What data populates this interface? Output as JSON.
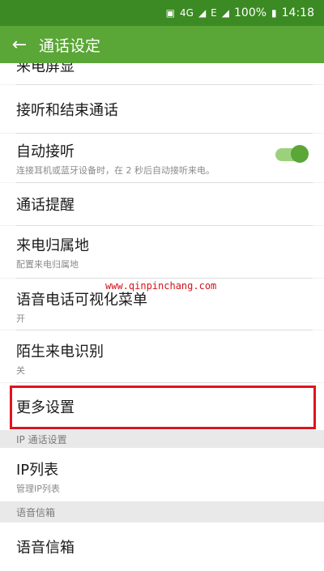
{
  "status_bar": {
    "signal_4g": "4G",
    "signal_e": "E",
    "battery": "100%",
    "time": "14:18"
  },
  "app_bar": {
    "title": "通话设定"
  },
  "list": {
    "partial_top": "来电屏显",
    "answer_end": {
      "title": "接听和结束通话"
    },
    "auto_answer": {
      "title": "自动接听",
      "subtitle": "连接耳机或蓝牙设备时，在 2 秒后自动接听来电。",
      "toggle_on": true
    },
    "call_alert": {
      "title": "通话提醒"
    },
    "caller_location": {
      "title": "来电归属地",
      "subtitle": "配置来电归属地"
    },
    "visual_voice_menu": {
      "title": "语音电话可视化菜单",
      "subtitle": "开"
    },
    "stranger_id": {
      "title": "陌生来电识别",
      "subtitle": "关"
    },
    "more_settings": {
      "title": "更多设置"
    },
    "ip_section_header": "IP 通话设置",
    "ip_list": {
      "title": "IP列表",
      "subtitle": "管理IP列表"
    },
    "voicemail_section_header": "语音信箱",
    "voicemail": {
      "title": "语音信箱"
    }
  },
  "watermark": "www.qinpinchang.com",
  "colors": {
    "app_bar": "#5aa637",
    "status_bar": "#3b8a23",
    "highlight": "#e0131d"
  }
}
